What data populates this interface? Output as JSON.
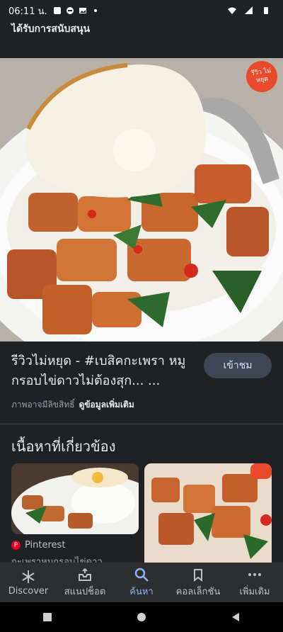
{
  "status_bar": {
    "time": "06:11 น."
  },
  "header": {
    "title": "ได้รับการสนับสนุน"
  },
  "hero": {
    "badge_text": "รีวิว ไม่หยุด"
  },
  "result": {
    "title": "รีวิวไม่หยุด - #เบสิคกะเพรา หมูกรอบไข่ดาวไม่ต้องสุก... ...",
    "visit_label": "เข้าชม",
    "copyright": "ภาพอาจมีลิขสิทธิ์",
    "more_info": "ดูข้อมูลเพิ่มเติม"
  },
  "related": {
    "title": "เนื้อหาที่เกี่ยวข้อง",
    "source": "Pinterest",
    "caption": "กะเพราหมูกรอบไข่ดาว"
  },
  "nav": {
    "items": [
      {
        "label": "Discover",
        "icon": "asterisk-icon"
      },
      {
        "label": "สแนปช็อต",
        "icon": "inbox-icon"
      },
      {
        "label": "ค้นหา",
        "icon": "search-icon"
      },
      {
        "label": "คอลเล็กชัน",
        "icon": "bookmarks-icon"
      },
      {
        "label": "เพิ่มเติม",
        "icon": "more-icon"
      }
    ],
    "active_index": 2
  },
  "colors": {
    "accent": "#8ab4f8",
    "background": "#202124",
    "nav_bg": "#2d2e30"
  }
}
